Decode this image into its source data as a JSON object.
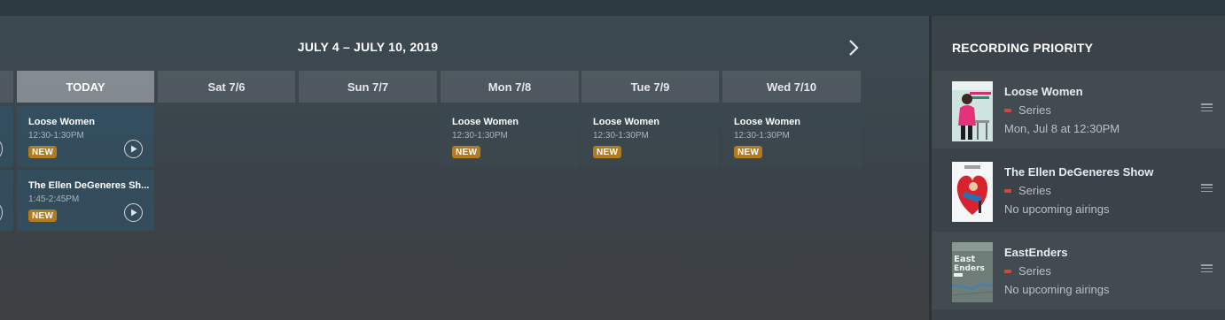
{
  "calendar": {
    "week_range": "JULY 4 – JULY 10, 2019",
    "next_icon": "chevron-right-icon",
    "days": [
      {
        "label": "TODAY",
        "is_today": true
      },
      {
        "label": "Sat 7/6"
      },
      {
        "label": "Sun 7/7"
      },
      {
        "label": "Mon 7/8"
      },
      {
        "label": "Tue 7/9"
      },
      {
        "label": "Wed 7/10"
      }
    ],
    "events": {
      "today_1": {
        "title": "Loose Women",
        "time": "12:30-1:30PM",
        "badge": "NEW"
      },
      "today_2": {
        "title": "The Ellen DeGeneres Sh...",
        "time": "1:45-2:45PM",
        "badge": "NEW"
      },
      "mon": {
        "title": "Loose Women",
        "time": "12:30-1:30PM",
        "badge": "NEW"
      },
      "tue": {
        "title": "Loose Women",
        "time": "12:30-1:30PM",
        "badge": "NEW"
      },
      "wed": {
        "title": "Loose Women",
        "time": "12:30-1:30PM",
        "badge": "NEW"
      }
    }
  },
  "sidebar": {
    "title": "RECORDING PRIORITY",
    "items": [
      {
        "name": "Loose Women",
        "type": "Series",
        "subtitle": "Mon, Jul 8 at 12:30PM"
      },
      {
        "name": "The Ellen DeGeneres Show",
        "type": "Series",
        "subtitle": "No upcoming airings"
      },
      {
        "name": "EastEnders",
        "type": "Series",
        "subtitle": "No upcoming airings"
      }
    ]
  },
  "colors": {
    "badge": "#b07c1e",
    "record_indicator": "#d9453a",
    "today_header": "#9aa3a8"
  }
}
